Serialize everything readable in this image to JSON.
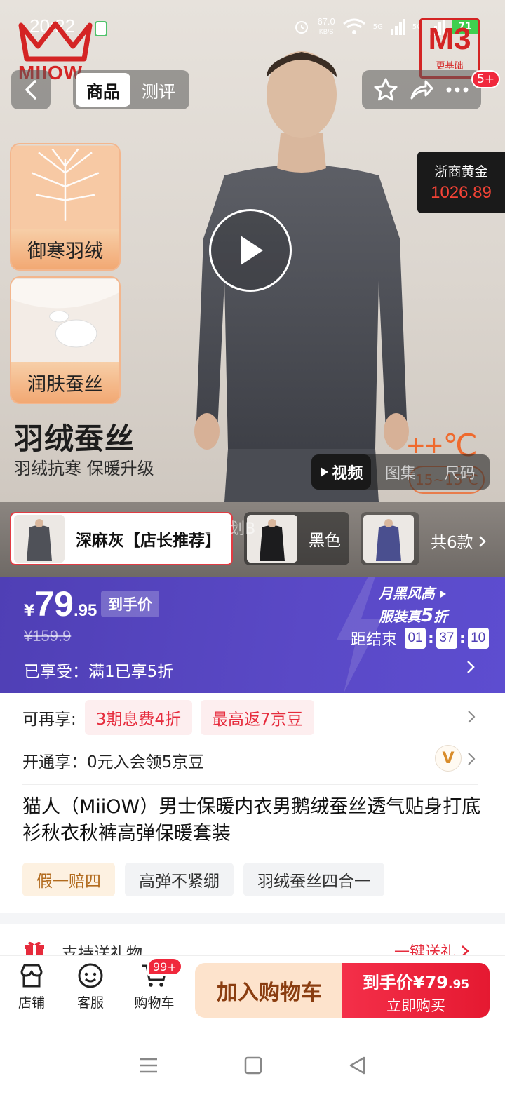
{
  "status_bar": {
    "time": "20:22",
    "speed_value": "67.0",
    "speed_unit": "KB/S",
    "network_1": "5G",
    "network_2": "5G",
    "battery": "71"
  },
  "brand": {
    "logo_text": "MIIOW",
    "badge_big": "M3",
    "badge_small": "更基础"
  },
  "nav": {
    "tabs": [
      {
        "label": "商品",
        "active": true
      },
      {
        "label": "测评",
        "active": false
      }
    ],
    "notification_count": "5+"
  },
  "gold_ticker": {
    "name": "浙商黄金",
    "price": "1026.89"
  },
  "features": [
    {
      "label": "御寒羽绒"
    },
    {
      "label": "润肤蚕丝"
    }
  ],
  "hero_text": {
    "title": "羽绒蚕丝",
    "subtitle": "羽绒抗寒  保暖升级",
    "temperature": "++℃",
    "temperature_range": "15~15℃"
  },
  "media_tabs": [
    {
      "label": "视频",
      "active": true
    },
    {
      "label": "图集",
      "active": false
    },
    {
      "label": "尺码",
      "active": false
    }
  ],
  "variants": {
    "items": [
      {
        "name": "深麻灰【店长推荐】",
        "selected": true
      },
      {
        "name": "黑色",
        "selected": false
      },
      {
        "name": "",
        "selected": false
      }
    ],
    "total_label": "共6款",
    "watermark": "B计划B"
  },
  "price": {
    "currency": "¥",
    "integer": "79",
    "decimal": ".95",
    "tag": "到手价",
    "original": "¥159.9",
    "enjoyed": "已享受：满1已享5折",
    "campaign_line1": "月黑风高",
    "campaign_line2_prefix": "服装真",
    "campaign_line2_num": "5",
    "campaign_line2_suffix": "折",
    "countdown_label": "距结束",
    "countdown": {
      "h": "01",
      "m": "37",
      "s": "10"
    }
  },
  "benefits": {
    "more_label": "可再享:",
    "chips": [
      "3期息费4折",
      "最高返7京豆"
    ],
    "membership": "开通享：0元入会领5京豆",
    "vip_icon_text": "V"
  },
  "product": {
    "title": "猫人（MiiOW）男士保暖内衣男鹅绒蚕丝透气贴身打底衫秋衣秋裤高弹保暖套装",
    "tags": [
      "假一赔四",
      "高弹不紧绷",
      "羽绒蚕丝四合一"
    ]
  },
  "gift": {
    "text": "支持送礼物",
    "link": "一键送礼"
  },
  "action_bar": {
    "shop": "店铺",
    "service": "客服",
    "cart": "购物车",
    "cart_badge": "99+",
    "add_to_cart": "加入购物车",
    "buy_price_label": "到手价",
    "buy_price_integer": "¥79",
    "buy_price_decimal": ".95",
    "buy_now": "立即购买"
  },
  "colors": {
    "accent_red": "#e62b3c",
    "banner_purple": "#4f3fb5",
    "cart_orange": "#fde3cc"
  }
}
